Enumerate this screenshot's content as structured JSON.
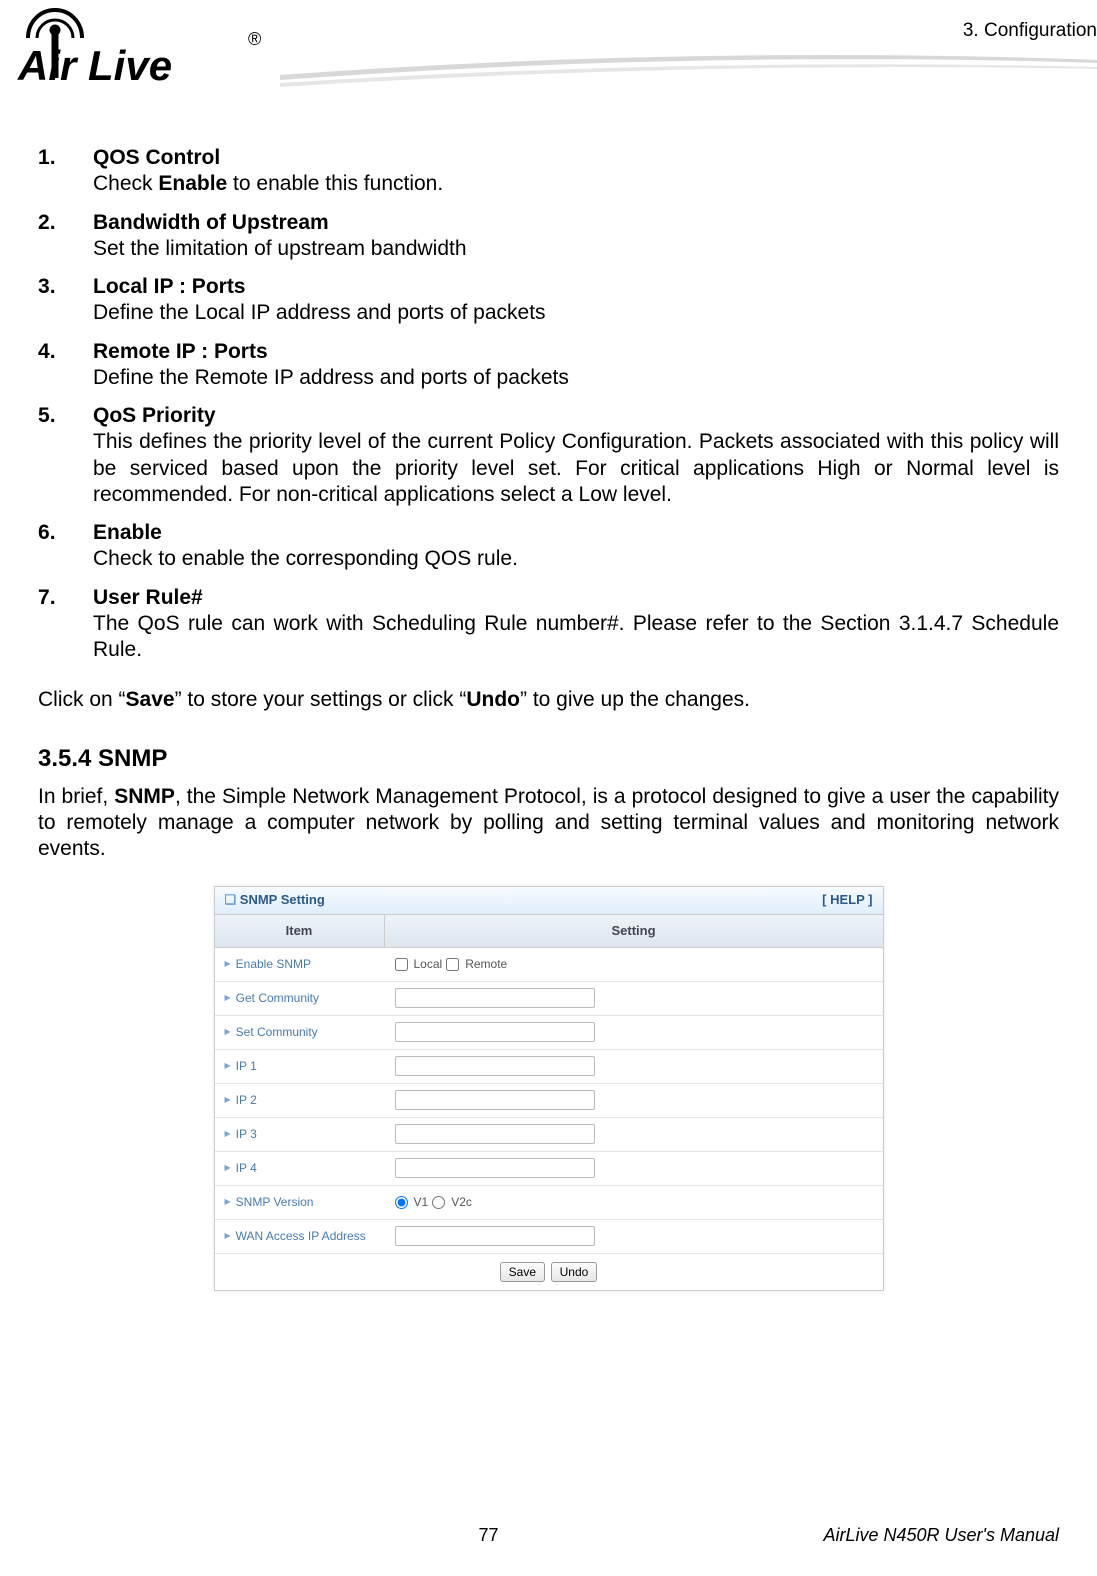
{
  "header": {
    "chapter": "3.  Configuration",
    "logo_main": "Air Live",
    "logo_super": "®"
  },
  "definitions": [
    {
      "title": "QOS Control",
      "desc_pre": "Check ",
      "desc_bold": "Enable",
      "desc_post": " to enable this function."
    },
    {
      "title": "Bandwidth of Upstream",
      "desc": "Set the limitation of upstream bandwidth"
    },
    {
      "title": "Local IP : Ports",
      "desc": "Define the Local IP address and ports of packets"
    },
    {
      "title": "Remote IP : Ports",
      "desc": "Define the Remote IP address and ports of packets"
    },
    {
      "title": "QoS Priority",
      "desc": "This defines the priority level of the current Policy Configuration. Packets associated with this policy will be serviced based upon the priority level set. For critical applications High or Normal level is recommended. For non-critical applications select a Low level."
    },
    {
      "title": "Enable",
      "desc": "Check to enable the corresponding QOS rule."
    },
    {
      "title": "User Rule#",
      "desc": "The QoS rule can work with Scheduling Rule number#. Please refer to the Section 3.1.4.7 Schedule Rule."
    }
  ],
  "save_line": {
    "p1": "Click on “",
    "b1": "Save",
    "p2": "” to store your settings or click “",
    "b2": "Undo",
    "p3": "” to give up the changes."
  },
  "section_354": "3.5.4 SNMP",
  "snmp_intro": {
    "p1": "In brief, ",
    "b1": "SNMP",
    "p2": ", the Simple Network Management Protocol, is a protocol designed to give a user the capability to remotely manage a computer network by polling and setting terminal values and monitoring network events."
  },
  "snmp_panel": {
    "title_icon": "□",
    "title": "SNMP Setting",
    "help": "[ HELP ]",
    "col_item": "Item",
    "col_setting": "Setting",
    "rows": {
      "enable_snmp": "Enable SNMP",
      "local": "Local",
      "remote": "Remote",
      "get_community": "Get Community",
      "set_community": "Set Community",
      "ip1": "IP 1",
      "ip2": "IP 2",
      "ip3": "IP 3",
      "ip4": "IP 4",
      "snmp_version": "SNMP Version",
      "v1": "V1",
      "v2c": "V2c",
      "wan_access": "WAN Access IP Address"
    },
    "save_btn": "Save",
    "undo_btn": "Undo"
  },
  "footer": {
    "page_number": "77",
    "manual": "AirLive N450R User's Manual"
  }
}
